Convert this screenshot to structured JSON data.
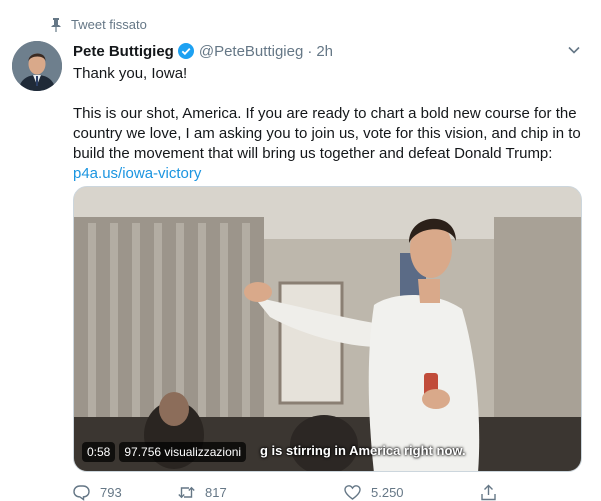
{
  "pinned": {
    "label": "Tweet fissato"
  },
  "author": {
    "name": "Pete Buttigieg",
    "handle": "@PeteButtigieg",
    "time": "2h",
    "separator": "·"
  },
  "tweet": {
    "line1": "Thank you, Iowa!",
    "body": "This is our shot, America. If you are ready to chart a bold new course for the country we love, I am asking you to join us, vote for this vision, and chip in to build the movement that will bring us together and defeat Donald Trump:",
    "link": "p4a.us/iowa-victory"
  },
  "media": {
    "caption_fragment": "g is stirring in America right now.",
    "duration": "0:58",
    "views": "97.756 visualizzazioni"
  },
  "actions": {
    "replies": "793",
    "retweets": "817",
    "likes": "5.250"
  },
  "colors": {
    "link": "#1b95e0",
    "muted": "#657786",
    "verified": "#1da1f2",
    "text": "#14171a"
  },
  "icons": [
    "pin-icon",
    "verified-icon",
    "chevron-down-icon",
    "reply-icon",
    "retweet-icon",
    "like-icon",
    "share-icon"
  ]
}
